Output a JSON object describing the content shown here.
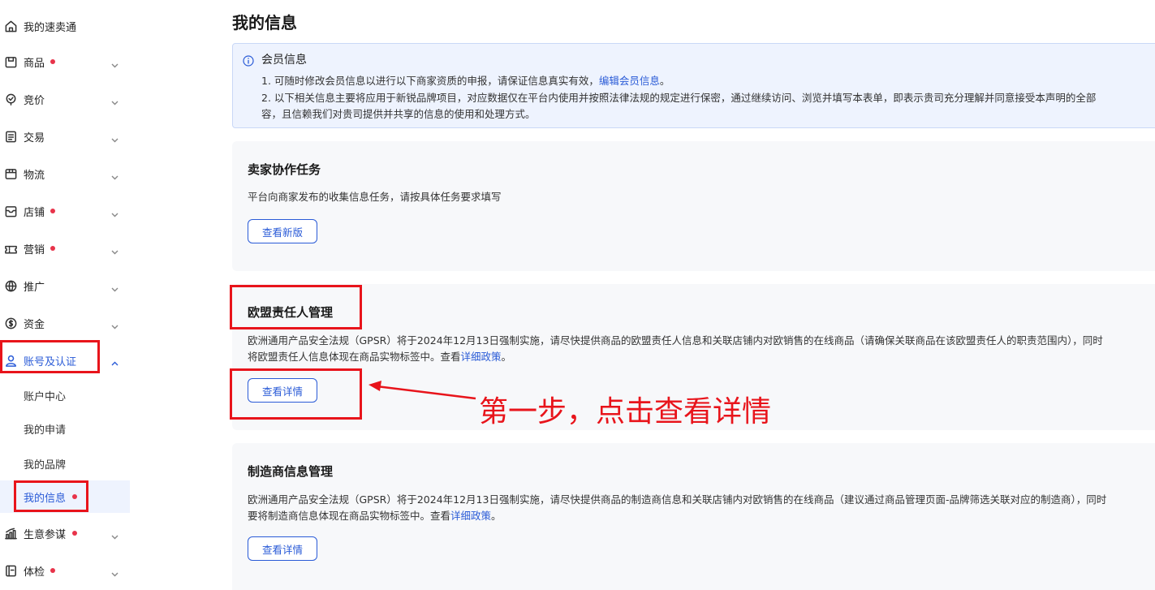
{
  "sidebar": {
    "items": [
      {
        "label": "我的速卖通",
        "icon": "home-icon",
        "dot": false,
        "chevron": false
      },
      {
        "label": "商品",
        "icon": "product-icon",
        "dot": true,
        "chevron": true
      },
      {
        "label": "竞价",
        "icon": "bid-icon",
        "dot": false,
        "chevron": true
      },
      {
        "label": "交易",
        "icon": "trade-icon",
        "dot": false,
        "chevron": true
      },
      {
        "label": "物流",
        "icon": "logistics-icon",
        "dot": false,
        "chevron": true
      },
      {
        "label": "店铺",
        "icon": "store-icon",
        "dot": true,
        "chevron": true
      },
      {
        "label": "营销",
        "icon": "marketing-icon",
        "dot": true,
        "chevron": true
      },
      {
        "label": "推广",
        "icon": "promotion-icon",
        "dot": false,
        "chevron": true
      },
      {
        "label": "资金",
        "icon": "funds-icon",
        "dot": false,
        "chevron": true
      },
      {
        "label": "账号及认证",
        "icon": "account-icon",
        "dot": false,
        "chevron": true,
        "expanded": true
      },
      {
        "label": "生意参谋",
        "icon": "analytics-icon",
        "dot": true,
        "chevron": true
      },
      {
        "label": "体检",
        "icon": "checkup-icon",
        "dot": true,
        "chevron": true
      }
    ],
    "sub_items": [
      {
        "label": "账户中心"
      },
      {
        "label": "我的申请"
      },
      {
        "label": "我的品牌"
      },
      {
        "label": "我的信息",
        "selected": true,
        "dot": true
      }
    ]
  },
  "main": {
    "title": "我的信息",
    "notice": {
      "title": "会员信息",
      "line1_prefix": "1. 可随时修改会员信息以进行以下商家资质的申报，请保证信息真实有效，",
      "line1_link": "编辑会员信息",
      "line1_suffix": "。",
      "line2": "2. 以下相关信息主要将应用于新锐品牌项目，对应数据仅在平台内使用并按照法律法规的规定进行保密，通过继续访问、浏览并填写本表单，即表示贵司充分理解并同意接受本声明的全部",
      "line3": "容，且信赖我们对贵司提供并共享的信息的使用和处理方式。"
    },
    "cards": [
      {
        "title": "卖家协作任务",
        "desc1": "平台向商家发布的收集信息任务，请按具体任务要求填写",
        "button": "查看新版"
      },
      {
        "title": "欧盟责任人管理",
        "desc1": "欧洲通用产品安全法规（GPSR）将于2024年12月13日强制实施，请尽快提供商品的欧盟责任人信息和关联店铺内对欧销售的在线商品（请确保关联商品在该欧盟责任人的职责范围内），同时",
        "desc2_prefix": "将欧盟责任人信息体现在商品实物标签中。查看",
        "desc2_link": "详细政策",
        "desc2_suffix": "。",
        "button": "查看详情"
      },
      {
        "title": "制造商信息管理",
        "desc1": "欧洲通用产品安全法规（GPSR）将于2024年12月13日强制实施，请尽快提供商品的制造商信息和关联店铺内对欧销售的在线商品（建议通过商品管理页面-品牌筛选关联对应的制造商），同时",
        "desc2_prefix": "要将制造商信息体现在商品实物标签中。查看",
        "desc2_link": "详细政策",
        "desc2_suffix": "。",
        "button": "查看详情"
      }
    ]
  },
  "annotation": {
    "text": "第一步，点击查看详情"
  },
  "colors": {
    "accent": "#2a5bd7",
    "dot": "#e8334a",
    "highlight_box": "#e8141b",
    "notice_bg": "#eef3fe"
  }
}
